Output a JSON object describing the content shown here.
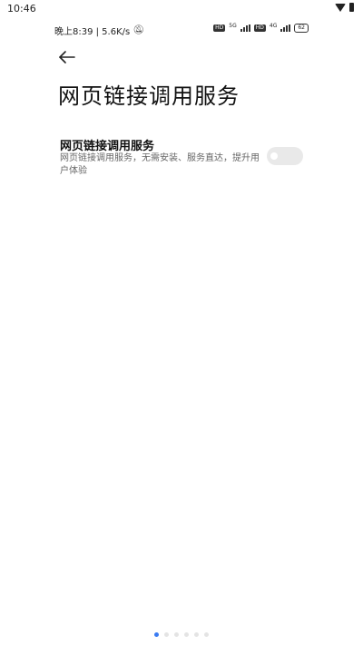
{
  "system_bar": {
    "time": "10:46",
    "icons": [
      "wifi-icon",
      "battery-icon"
    ]
  },
  "inner_status_bar": {
    "left_text": "晚上8:39 | 5.6K/s",
    "left_icon": "bell-off-icon",
    "sim1_hd": "HD",
    "sim1_network": "5G",
    "sim2_hd": "HD",
    "sim2_network": "4G",
    "battery": "62"
  },
  "header": {
    "back_icon": "back-arrow-icon",
    "title": "网页链接调用服务"
  },
  "setting": {
    "title": "网页链接调用服务",
    "description": "网页链接调用服务，无需安装、服务直达，提升用户体验",
    "toggle_on": false
  },
  "pager": {
    "count": 6,
    "active_index": 0,
    "active_color": "#3a7bf2"
  }
}
